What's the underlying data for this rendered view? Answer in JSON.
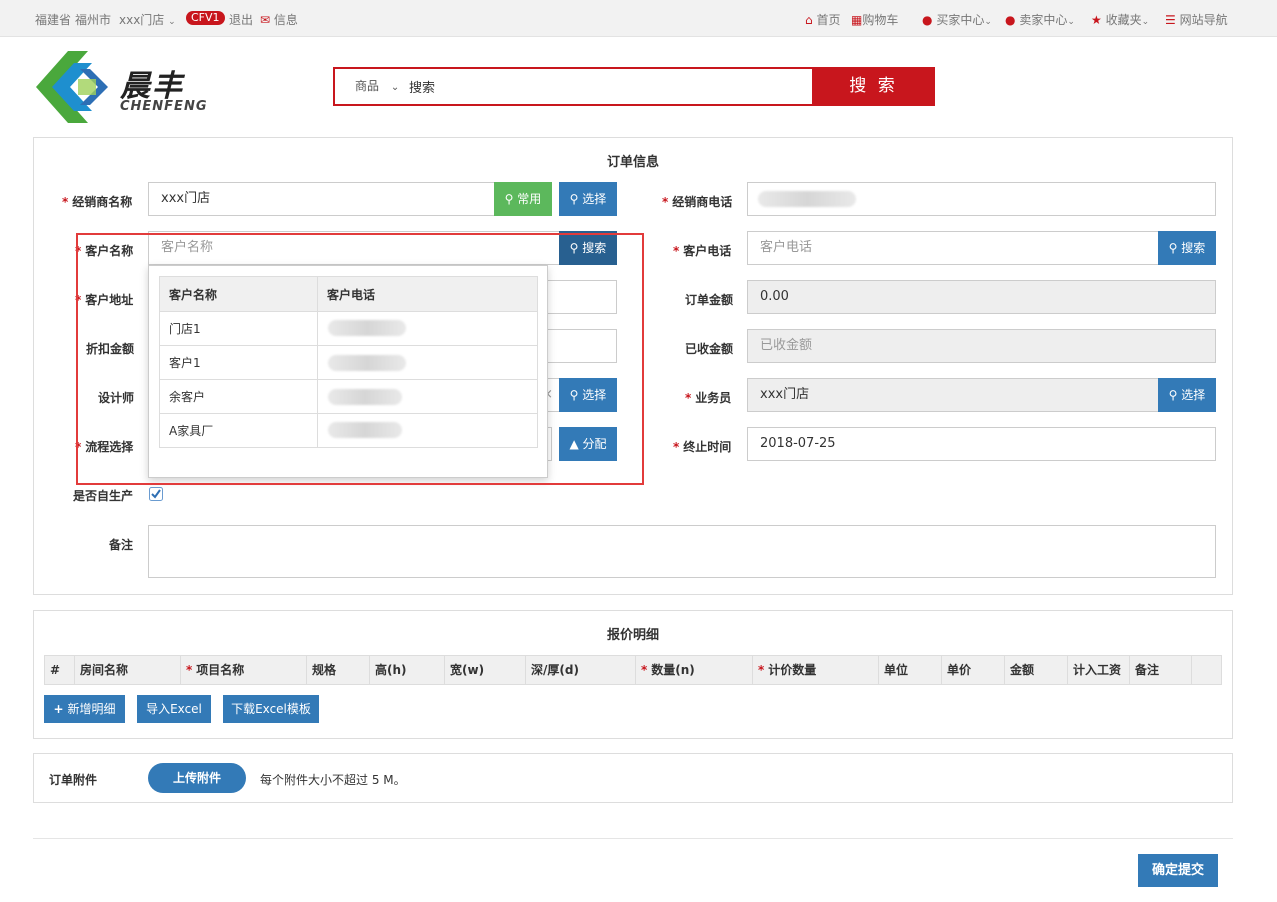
{
  "topbar": {
    "province": "福建省",
    "city": "福州市",
    "store": "xxx门店",
    "badge": "CFV1",
    "logout": "退出",
    "messages": "信息",
    "home": "首页",
    "cart": "购物车",
    "buyer_center": "买家中心",
    "seller_center": "卖家中心",
    "favorites": "收藏夹",
    "site_nav": "网站导航"
  },
  "logo": {
    "cn": "晨丰",
    "en": "CHENFENG"
  },
  "search": {
    "category": "商品",
    "value": "搜索",
    "button": "搜 索"
  },
  "order": {
    "title": "订单信息",
    "dealer_name_label": "经销商名称",
    "dealer_name_value": "xxx门店",
    "common_btn": "常用",
    "select_btn": "选择",
    "dealer_phone_label": "经销商电话",
    "customer_name_label": "客户名称",
    "customer_name_placeholder": "客户名称",
    "search_btn": "搜索",
    "customer_phone_label": "客户电话",
    "customer_phone_placeholder": "客户电话",
    "customer_address_label": "客户地址",
    "order_amount_label": "订单金额",
    "order_amount_value": "0.00",
    "discount_label": "折扣金额",
    "received_label": "已收金额",
    "received_placeholder": "已收金额",
    "designer_label": "设计师",
    "salesman_label": "业务员",
    "salesman_value": "xxx门店",
    "flow_label": "流程选择",
    "assign_btn": "分配",
    "end_time_label": "终止时间",
    "end_time_value": "2018-07-25",
    "self_produce_label": "是否自生产",
    "remark_label": "备注"
  },
  "popup": {
    "headers": [
      "客户名称",
      "客户电话"
    ],
    "rows": [
      "门店1",
      "客户1",
      "余客户",
      "A家具厂"
    ]
  },
  "quote": {
    "title": "报价明细",
    "columns": [
      {
        "label": "#",
        "required": false
      },
      {
        "label": "房间名称",
        "required": false
      },
      {
        "label": "项目名称",
        "required": true
      },
      {
        "label": "规格",
        "required": false
      },
      {
        "label": "高(h)",
        "required": false
      },
      {
        "label": "宽(w)",
        "required": false
      },
      {
        "label": "深/厚(d)",
        "required": false
      },
      {
        "label": "数量(n)",
        "required": true
      },
      {
        "label": "计价数量",
        "required": true
      },
      {
        "label": "单位",
        "required": false
      },
      {
        "label": "单价",
        "required": false
      },
      {
        "label": "金额",
        "required": false
      },
      {
        "label": "计入工资",
        "required": false
      },
      {
        "label": "备注",
        "required": false
      }
    ],
    "add_btn": "新增明细",
    "import_btn": "导入Excel",
    "download_btn": "下载Excel模板"
  },
  "attachment": {
    "label": "订单附件",
    "upload_btn": "上传附件",
    "note": "每个附件大小不超过 5 M。"
  },
  "submit_btn": "确定提交",
  "colors": {
    "brand_red": "#c8161d",
    "blue": "#337ab7",
    "green": "#5cb85c"
  }
}
